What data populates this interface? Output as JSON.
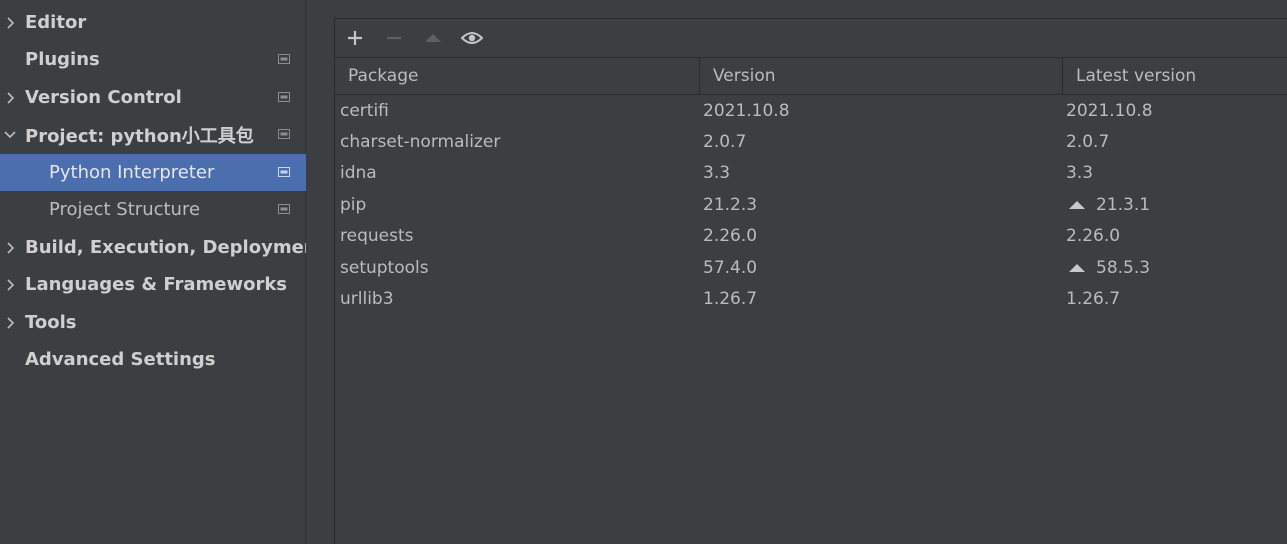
{
  "sidebar": {
    "items": [
      {
        "label": "Editor",
        "arrow": "collapsed",
        "badge": false
      },
      {
        "label": "Plugins",
        "arrow": "none",
        "badge": true
      },
      {
        "label": "Version Control",
        "arrow": "collapsed",
        "badge": true
      },
      {
        "label": "Project: python小工具包",
        "arrow": "expanded",
        "badge": true
      },
      {
        "label": "Python Interpreter",
        "arrow": "none",
        "badge": true,
        "child": true,
        "selected": true
      },
      {
        "label": "Project Structure",
        "arrow": "none",
        "badge": true,
        "child": true
      },
      {
        "label": "Build, Execution, Deployment",
        "arrow": "collapsed",
        "badge": false
      },
      {
        "label": "Languages & Frameworks",
        "arrow": "collapsed",
        "badge": false
      },
      {
        "label": "Tools",
        "arrow": "collapsed",
        "badge": false
      },
      {
        "label": "Advanced Settings",
        "arrow": "none",
        "badge": false
      }
    ]
  },
  "toolbar": {
    "buttons": [
      {
        "icon": "plus-icon",
        "enabled": true
      },
      {
        "icon": "minus-icon",
        "enabled": false
      },
      {
        "icon": "upgrade-arrow-icon",
        "enabled": false
      },
      {
        "icon": "eye-icon",
        "enabled": true
      }
    ]
  },
  "table": {
    "columns": [
      "Package",
      "Version",
      "Latest version"
    ],
    "rows": [
      {
        "package": "certifi",
        "version": "2021.10.8",
        "latest": "2021.10.8",
        "upgrade": false
      },
      {
        "package": "charset-normalizer",
        "version": "2.0.7",
        "latest": "2.0.7",
        "upgrade": false
      },
      {
        "package": "idna",
        "version": "3.3",
        "latest": "3.3",
        "upgrade": false
      },
      {
        "package": "pip",
        "version": "21.2.3",
        "latest": "21.3.1",
        "upgrade": true
      },
      {
        "package": "requests",
        "version": "2.26.0",
        "latest": "2.26.0",
        "upgrade": false
      },
      {
        "package": "setuptools",
        "version": "57.4.0",
        "latest": "58.5.3",
        "upgrade": true
      },
      {
        "package": "urllib3",
        "version": "1.26.7",
        "latest": "1.26.7",
        "upgrade": false
      }
    ]
  },
  "colors": {
    "background": "#3c3f41",
    "selection": "#4b6eaf",
    "text": "#bbbbbb",
    "border": "#2b2b2b"
  }
}
